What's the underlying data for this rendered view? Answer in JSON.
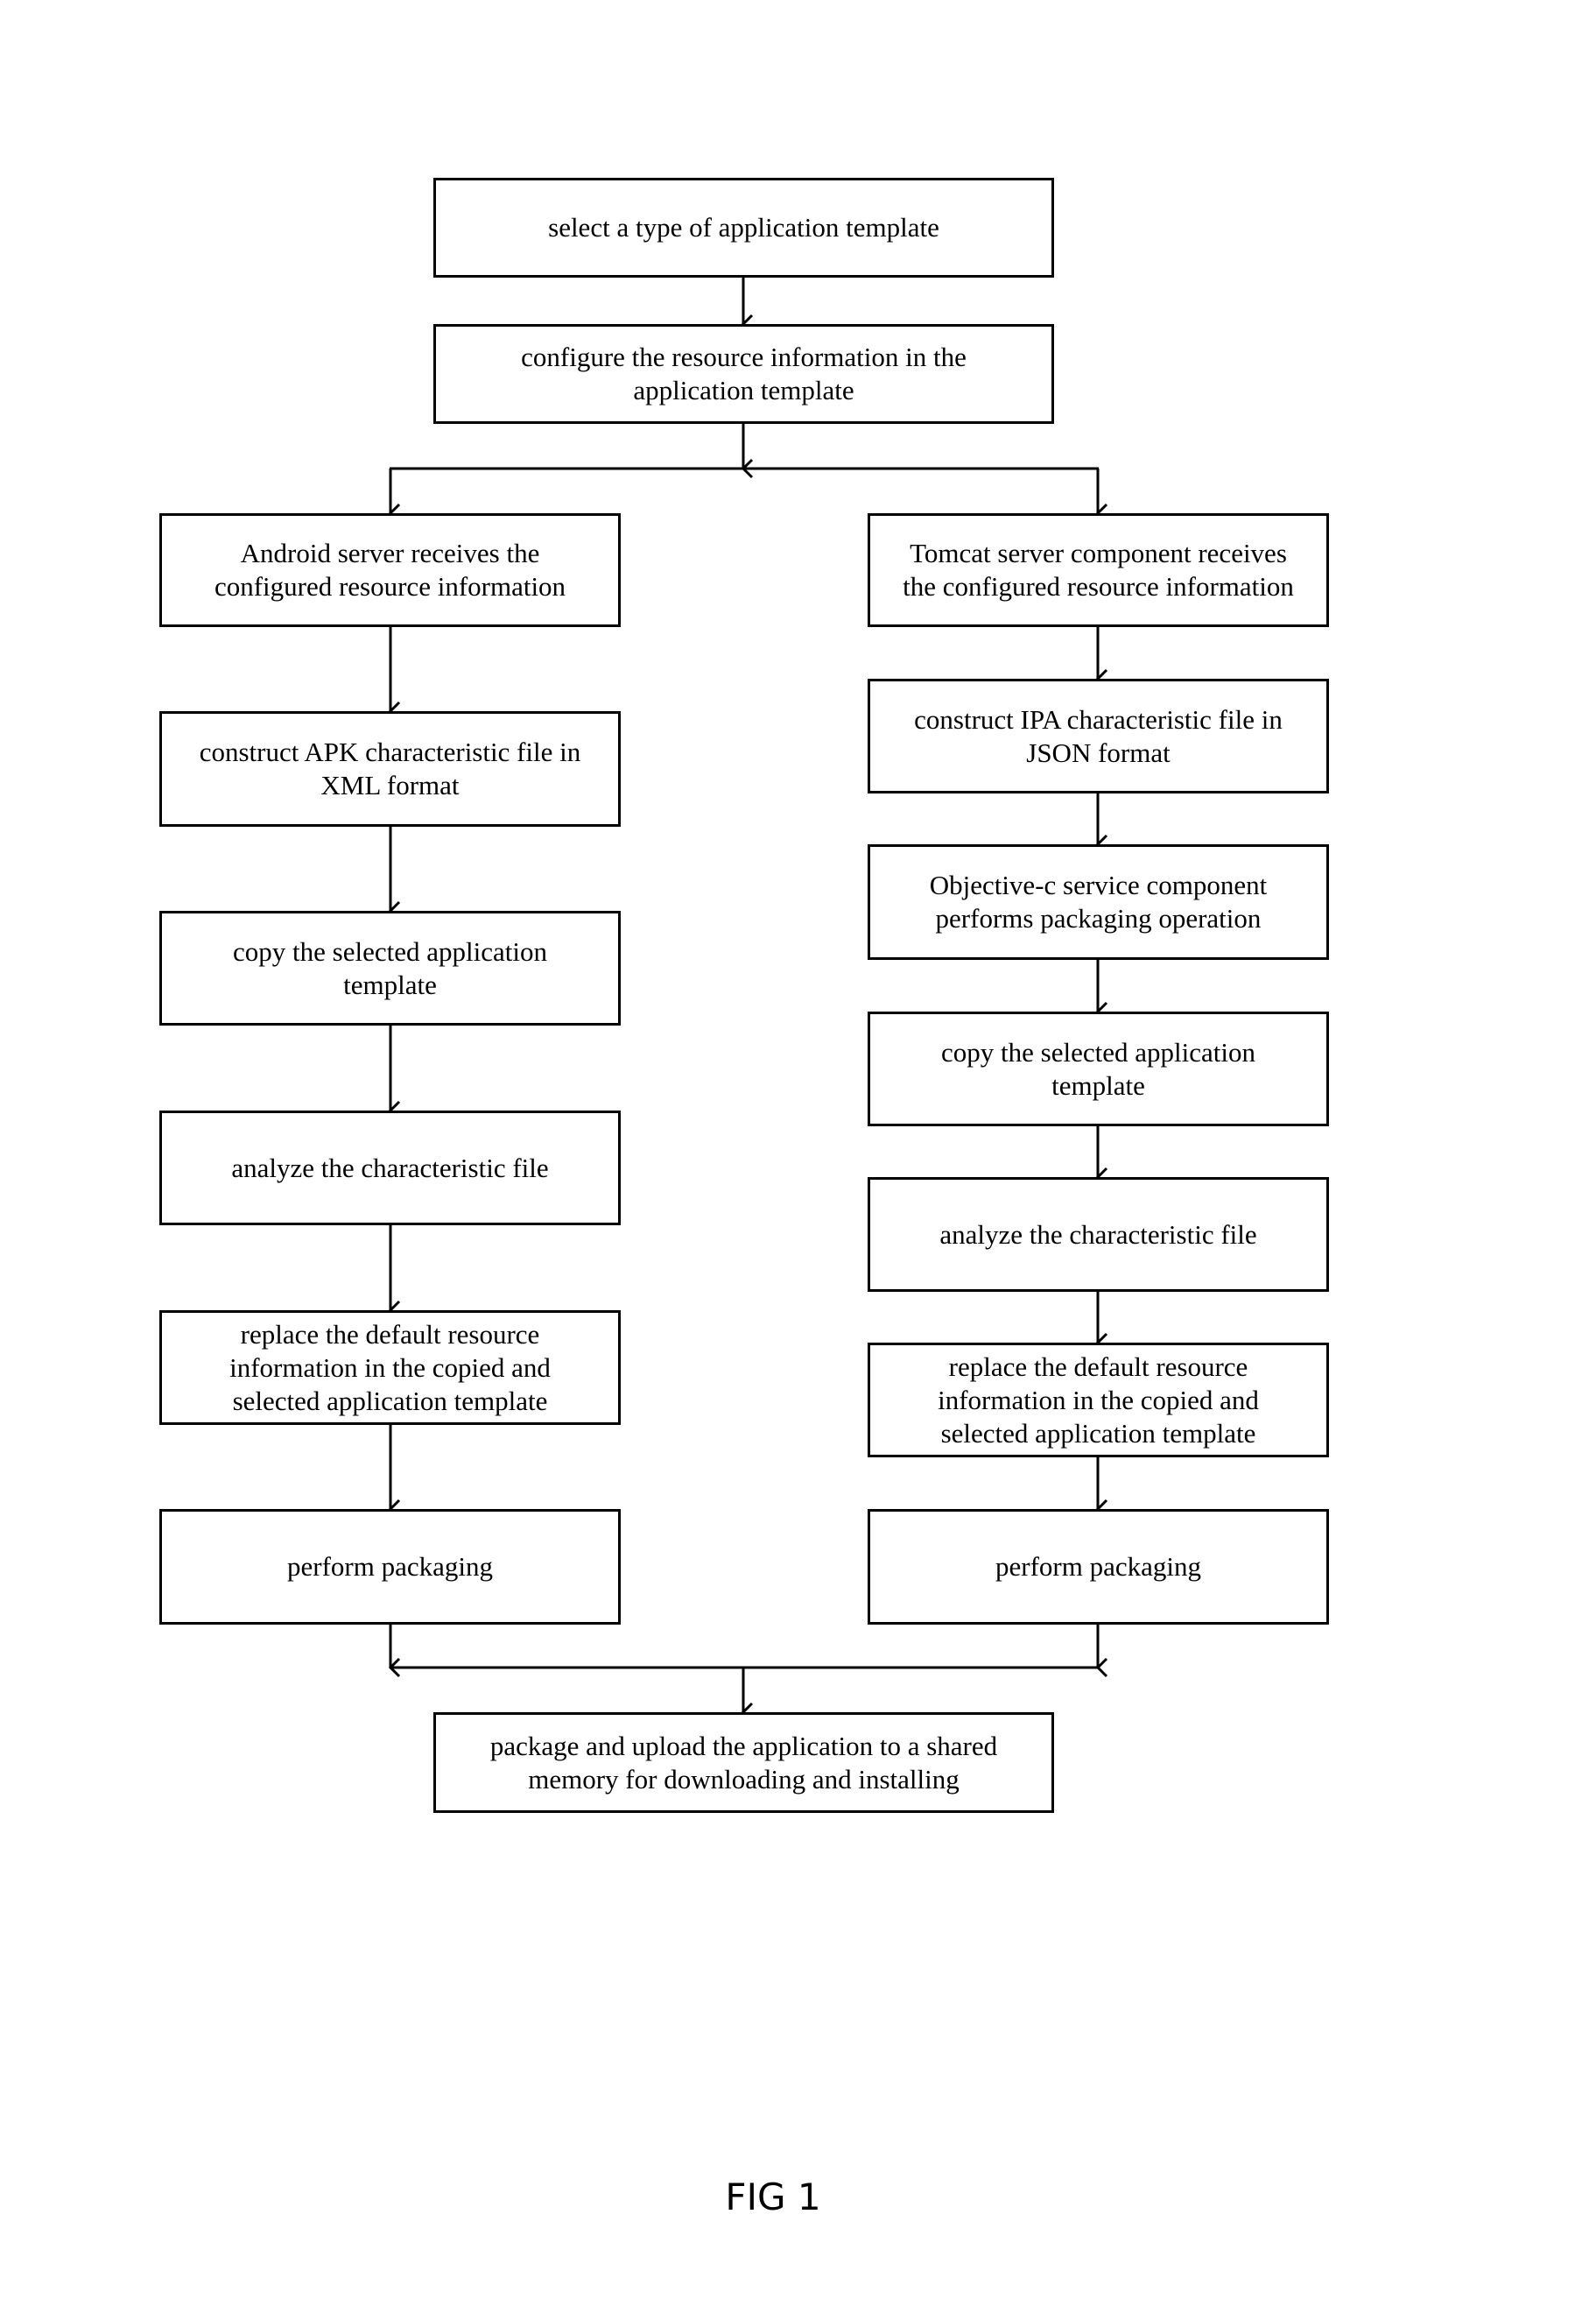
{
  "figure": {
    "label": "FIG 1",
    "line_color": "#000000",
    "steps": {
      "select_template": "select a type of application template",
      "configure_resources": "configure the resource information in the\napplication template",
      "android_receive": "Android server receives the\nconfigured resource information",
      "android_construct_apk": "construct APK characteristic file in\nXML format",
      "android_copy_template": "copy the selected application\ntemplate",
      "android_analyze": "analyze the characteristic file",
      "android_replace": "replace the default resource\ninformation in the copied and\nselected application template",
      "android_package": "perform packaging",
      "tomcat_receive": "Tomcat server component receives\nthe configured resource information",
      "ios_construct_ipa": "construct IPA characteristic file in\nJSON format",
      "objc_packaging": "Objective-c service component\nperforms packaging operation",
      "ios_copy_template": "copy the selected application\ntemplate",
      "ios_analyze": "analyze the characteristic file",
      "ios_replace": "replace the default resource\ninformation in the copied and\nselected application template",
      "ios_package": "perform packaging",
      "upload": "package and upload the  application to a shared\nmemory for downloading and installing"
    }
  }
}
